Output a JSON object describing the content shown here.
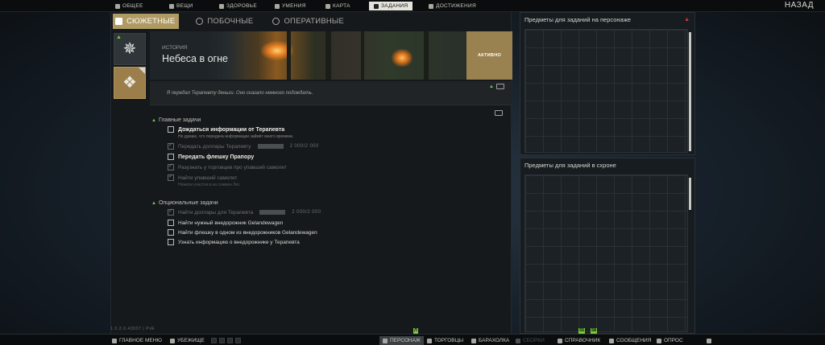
{
  "top_nav": {
    "tabs": [
      {
        "label": "ОБЩЕЕ",
        "icon": "info-icon"
      },
      {
        "label": "ВЕЩИ",
        "icon": "bag-icon"
      },
      {
        "label": "ЗДОРОВЬЕ",
        "icon": "heart-icon"
      },
      {
        "label": "УМЕНИЯ",
        "icon": "skills-icon"
      },
      {
        "label": "КАРТА",
        "icon": "map-pin-icon"
      },
      {
        "label": "ЗАДАНИЯ",
        "icon": "tasks-icon"
      },
      {
        "label": "ДОСТИЖЕНИЯ",
        "icon": "achievements-icon"
      }
    ],
    "active_tab": "ЗАДАНИЯ",
    "back_label": "НАЗАД"
  },
  "category_tabs": [
    {
      "label": "СЮЖЕТНЫЕ",
      "icon": "story-icon",
      "active": true
    },
    {
      "label": "ПОБОЧНЫЕ",
      "icon": "side-quest-icon",
      "active": false
    },
    {
      "label": "ОПЕРАТИВНЫЕ",
      "icon": "operational-icon",
      "active": false
    }
  ],
  "quest": {
    "category_label": "История",
    "title": "Небеса в огне",
    "status": "АКТИВНО",
    "description": "Я передал Терапевту деньги. Оно сказало немного подождать."
  },
  "main_objectives": {
    "header": "Главные задачи",
    "items": [
      {
        "text": "Дождаться информации от Терапевта",
        "note": "Не думаю, что передача информации займёт много времени.",
        "done": false,
        "bold": true
      },
      {
        "text": "Передать доллары Терапевту",
        "progress": "2 000/2 000",
        "done": true
      },
      {
        "text": "Передать флешку Прапору",
        "done": false,
        "bold": true
      },
      {
        "text": "Разузнать у торговцев про упавший самолет",
        "done": true
      },
      {
        "text": "Найти упавший самолет",
        "note": "Нежели участок в на сожжен Лес",
        "done": true
      }
    ]
  },
  "optional_objectives": {
    "header": "Опциональные задачи",
    "items": [
      {
        "text": "Найти доллары для Терапевта",
        "progress": "2 000/2 000",
        "done": true
      },
      {
        "text": "Найти нужный внедорожник Gelandewagen",
        "done": false
      },
      {
        "text": "Найти флешку в одном из внедорожников Gelandewagen",
        "done": false
      },
      {
        "text": "Узнать информацию о внедорожнике у Терапевта",
        "done": false
      }
    ]
  },
  "side_panels": {
    "character_items_title": "Предметы для заданий на персонаже",
    "stash_items_title": "Предметы для заданий в схроне"
  },
  "version": "1.0.2.0.43037 | PvE",
  "bottom_nav": {
    "items": [
      {
        "label": "ГЛАВНОЕ МЕНЮ",
        "icon": "menu-icon"
      },
      {
        "label": "УБЕЖИЩЕ",
        "icon": "hideout-icon"
      },
      {
        "label": "ПЕРСОНАЖ",
        "icon": "character-icon",
        "active": true
      },
      {
        "label": "ТОРГОВЦЫ",
        "icon": "traders-icon"
      },
      {
        "label": "БАРАХОЛКА",
        "icon": "flea-market-icon"
      },
      {
        "label": "СБОРКИ",
        "icon": "builds-icon",
        "disabled": true
      },
      {
        "label": "СПРАВОЧНИК",
        "icon": "handbook-icon"
      },
      {
        "label": "СООБЩЕНИЯ",
        "icon": "messages-icon"
      },
      {
        "label": "ОПРОС",
        "icon": "survey-icon"
      }
    ],
    "badges": {
      "character": "Л",
      "handbook_a": "55",
      "handbook_b": "58"
    }
  },
  "colors": {
    "accent": "#b09a63",
    "status_active": "#9a8250",
    "green": "#6cd03c",
    "red_marker": "#d03a3a"
  }
}
